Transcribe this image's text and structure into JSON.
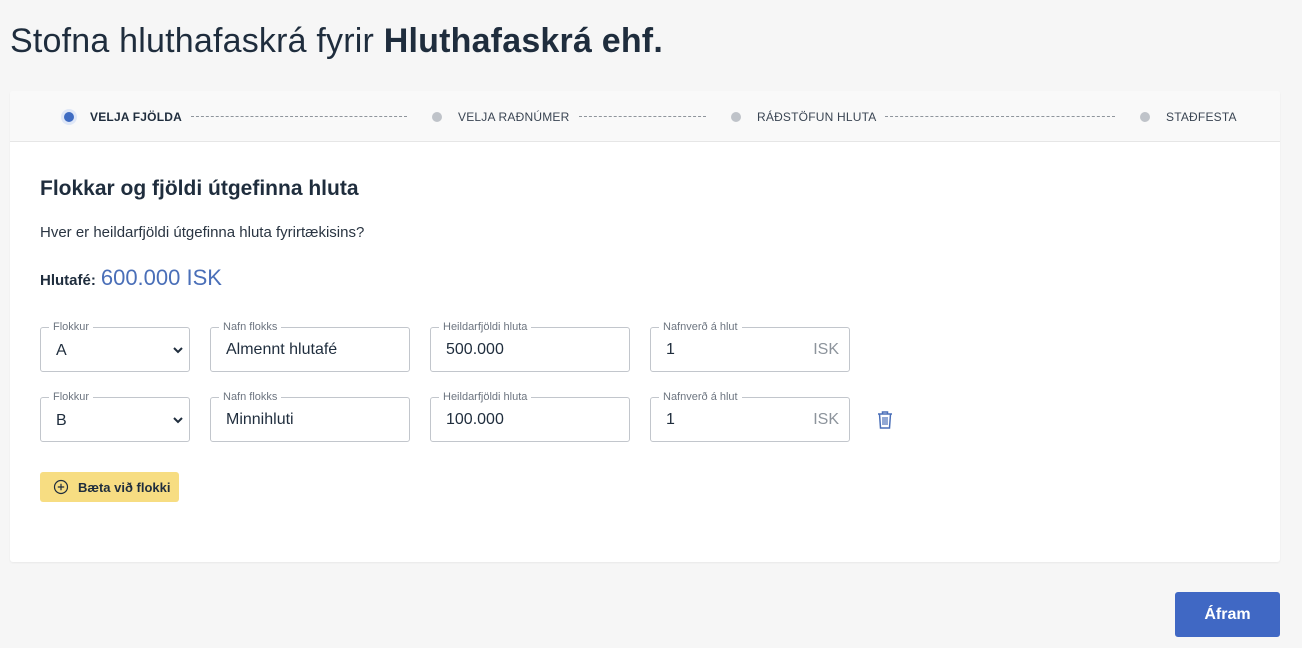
{
  "page": {
    "title_prefix": "Stofna hluthafaskrá fyrir",
    "company_name": "Hluthafaskrá ehf."
  },
  "stepper": {
    "steps": [
      {
        "label": "VELJA FJÖLDA",
        "active": true
      },
      {
        "label": "VELJA RAÐNÚMER",
        "active": false
      },
      {
        "label": "RÁÐSTÖFUN HLUTA",
        "active": false
      },
      {
        "label": "STAÐFESTA",
        "active": false
      }
    ]
  },
  "section": {
    "title": "Flokkar og fjöldi útgefinna hluta",
    "question": "Hver er heildarfjöldi útgefinna hluta fyrirtækisins?",
    "capital_label": "Hlutafé:",
    "capital_value": "600.000 ISK"
  },
  "labels": {
    "class": "Flokkur",
    "class_name": "Nafn flokks",
    "total_shares": "Heildarfjöldi hluta",
    "par_value": "Nafnverð á hlut",
    "currency": "ISK"
  },
  "rows": [
    {
      "class": "A",
      "name": "Almennt hlutafé",
      "total": "500.000",
      "par": "1"
    },
    {
      "class": "B",
      "name": "Minnihluti",
      "total": "100.000",
      "par": "1"
    }
  ],
  "buttons": {
    "add_class": "Bæta við flokki",
    "next": "Áfram"
  },
  "icons": {
    "add": "plus-circle-icon",
    "delete": "trash-icon",
    "dropdown": "chevron-down-icon"
  },
  "colors": {
    "accent": "#4068c4",
    "capital": "#4a6fb8",
    "add_button": "#f7dd82",
    "active_step_dot": "#3f6cc2"
  }
}
